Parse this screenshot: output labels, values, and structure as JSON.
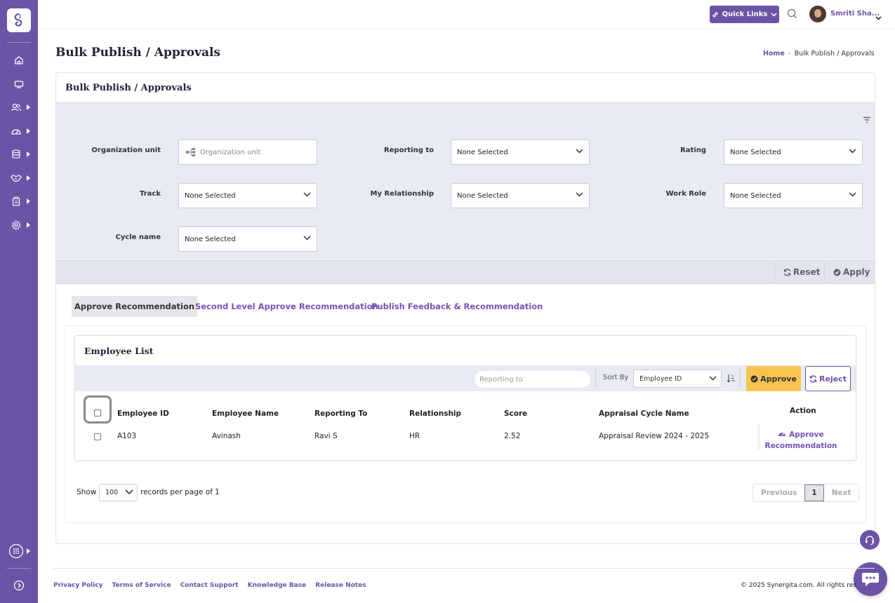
{
  "header": {
    "quick_links_label": "Quick Links",
    "user_name": "Smriti Sha..."
  },
  "page": {
    "title": "Bulk Publish / Approvals",
    "breadcrumb": {
      "home": "Home",
      "current": "Bulk Publish / Approvals"
    }
  },
  "card": {
    "title": "Bulk Publish / Approvals"
  },
  "filters": {
    "org_unit": {
      "label": "Organization unit",
      "placeholder": "Organization unit"
    },
    "reporting_to": {
      "label": "Reporting to",
      "value": "None Selected"
    },
    "rating": {
      "label": "Rating",
      "value": "None Selected"
    },
    "track": {
      "label": "Track",
      "value": "None Selected"
    },
    "my_relationship": {
      "label": "My Relationship",
      "value": "None Selected"
    },
    "work_role": {
      "label": "Work Role",
      "value": "None Selected"
    },
    "cycle_name": {
      "label": "Cycle name",
      "value": "None Selected"
    },
    "reset_label": "Reset",
    "apply_label": "Apply"
  },
  "tabs": [
    {
      "label": "Approve Recommendation",
      "active": true
    },
    {
      "label": "Second Level Approve Recommendation",
      "active": false
    },
    {
      "label": "Publish Feedback & Recommendation",
      "active": false
    }
  ],
  "employee_list": {
    "title": "Employee List",
    "search_placeholder": "Reporting to",
    "sort_by_label": "Sort By",
    "sort_by_value": "Employee ID",
    "approve_label": "Approve",
    "reject_label": "Reject",
    "columns": [
      "Employee ID",
      "Employee Name",
      "Reporting To",
      "Relationship",
      "Score",
      "Appraisal Cycle Name",
      "Action"
    ],
    "rows": [
      {
        "employee_id": "A103",
        "employee_name": "Avinash",
        "reporting_to": "Ravi S",
        "relationship": "HR",
        "score": "2.52",
        "cycle": "Appraisal Review 2024 - 2025",
        "action": "Approve Recommendation"
      }
    ]
  },
  "pagination": {
    "show_label": "Show",
    "page_size": "100",
    "per_page_text": "records per page of 1",
    "previous": "Previous",
    "current": "1",
    "next": "Next"
  },
  "footer": {
    "links": [
      "Privacy Policy",
      "Terms of Service",
      "Contact Support",
      "Knowledge Base",
      "Release Notes"
    ],
    "copyright": "© 2025 Synergita.com. All rights res"
  },
  "colors": {
    "brand": "#6b54a5",
    "approve": "#f9c34f",
    "filter_bg": "#e9ebf3"
  }
}
